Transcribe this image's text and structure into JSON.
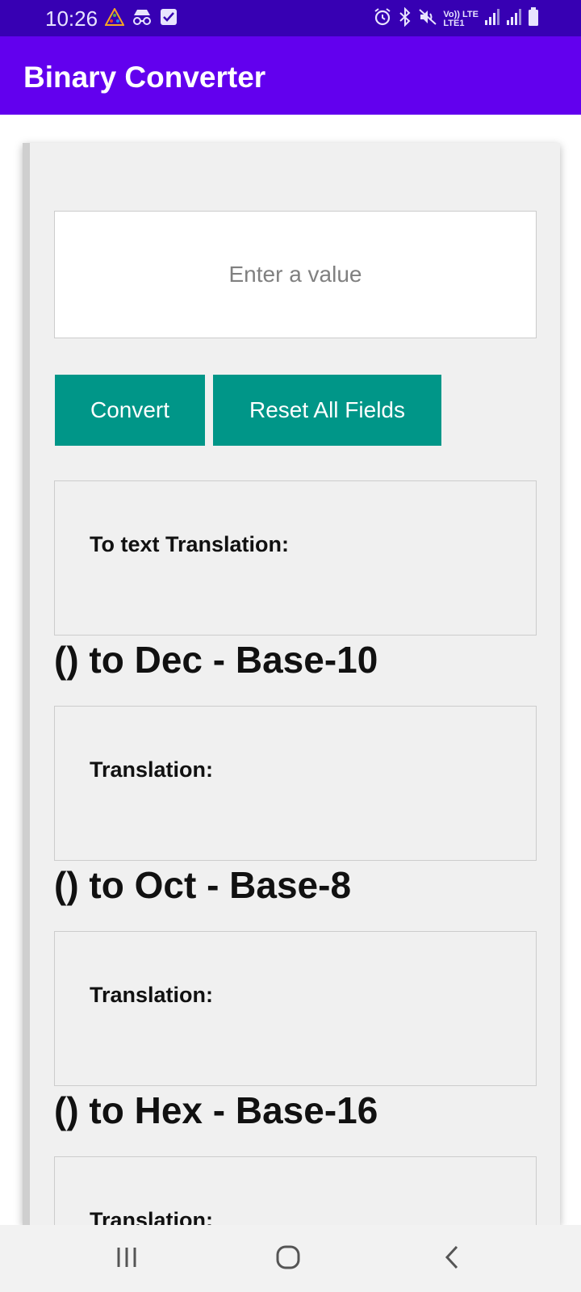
{
  "status_bar": {
    "time": "10:26",
    "signal_text_top": "Vo)) LTE",
    "signal_text_bottom": "LTE1",
    "left_icons": [
      "triangle-app-icon",
      "incognito-icon",
      "checkbox-icon"
    ],
    "right_icons": [
      "alarm-icon",
      "bluetooth-icon",
      "mute-icon",
      "volte-icon",
      "signal-icon",
      "signal-icon",
      "battery-icon"
    ]
  },
  "app_bar": {
    "title": "Binary Converter",
    "color": "#6200ee"
  },
  "input": {
    "placeholder": "Enter a value",
    "value": ""
  },
  "buttons": {
    "convert": "Convert",
    "reset": "Reset All Fields",
    "color": "#009688"
  },
  "results": {
    "text": {
      "label": "To text Translation:"
    },
    "dec": {
      "heading": "() to Dec - Base-10",
      "label": "Translation:"
    },
    "oct": {
      "heading": "() to Oct - Base-8",
      "label": "Translation:"
    },
    "hex": {
      "heading": "() to Hex - Base-16",
      "label": "Translation:"
    }
  },
  "nav_bar": {
    "icons": [
      "recent-apps-icon",
      "home-icon",
      "back-icon"
    ]
  }
}
